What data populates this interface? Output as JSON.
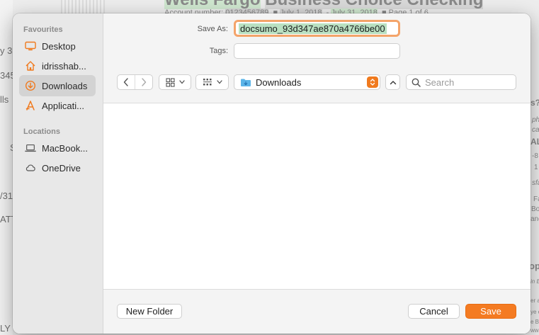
{
  "background": {
    "title_part1": "Wells Fargo",
    "title_part2": "Business Choice Checking",
    "account_label": "Account number:",
    "account_number": "0123456789",
    "date_from": "July 1, 2018",
    "date_to": "July 31, 2018",
    "page_info": "Page 1 of 6",
    "left_fragments": [
      "y 3",
      "345",
      "lls",
      "S",
      "/31",
      "ATT",
      "LY"
    ],
    "right_fragments": [
      "s?",
      "ph",
      "ca",
      "AL",
      "-8",
      "1",
      "sfa",
      "Fa",
      "Bo",
      "and",
      "op",
      "in B",
      "er a",
      "ye e",
      "e B",
      "ww"
    ]
  },
  "dialog": {
    "save_as_label": "Save As:",
    "filename": "docsumo_93d347ae870a4766be00",
    "tags_label": "Tags:",
    "location": "Downloads",
    "search_placeholder": "Search",
    "new_folder_button": "New Folder",
    "cancel_button": "Cancel",
    "save_button": "Save",
    "accent_color": "#f47b22"
  },
  "sidebar": {
    "favourites_title": "Favourites",
    "locations_title": "Locations",
    "favourites": [
      {
        "label": "Desktop",
        "icon": "desktop-icon"
      },
      {
        "label": "idrisshab...",
        "icon": "home-icon"
      },
      {
        "label": "Downloads",
        "icon": "downloads-icon",
        "selected": true
      },
      {
        "label": "Applicati...",
        "icon": "applications-icon"
      }
    ],
    "locations": [
      {
        "label": "MacBook...",
        "icon": "laptop-icon"
      },
      {
        "label": "OneDrive",
        "icon": "cloud-icon"
      }
    ]
  }
}
